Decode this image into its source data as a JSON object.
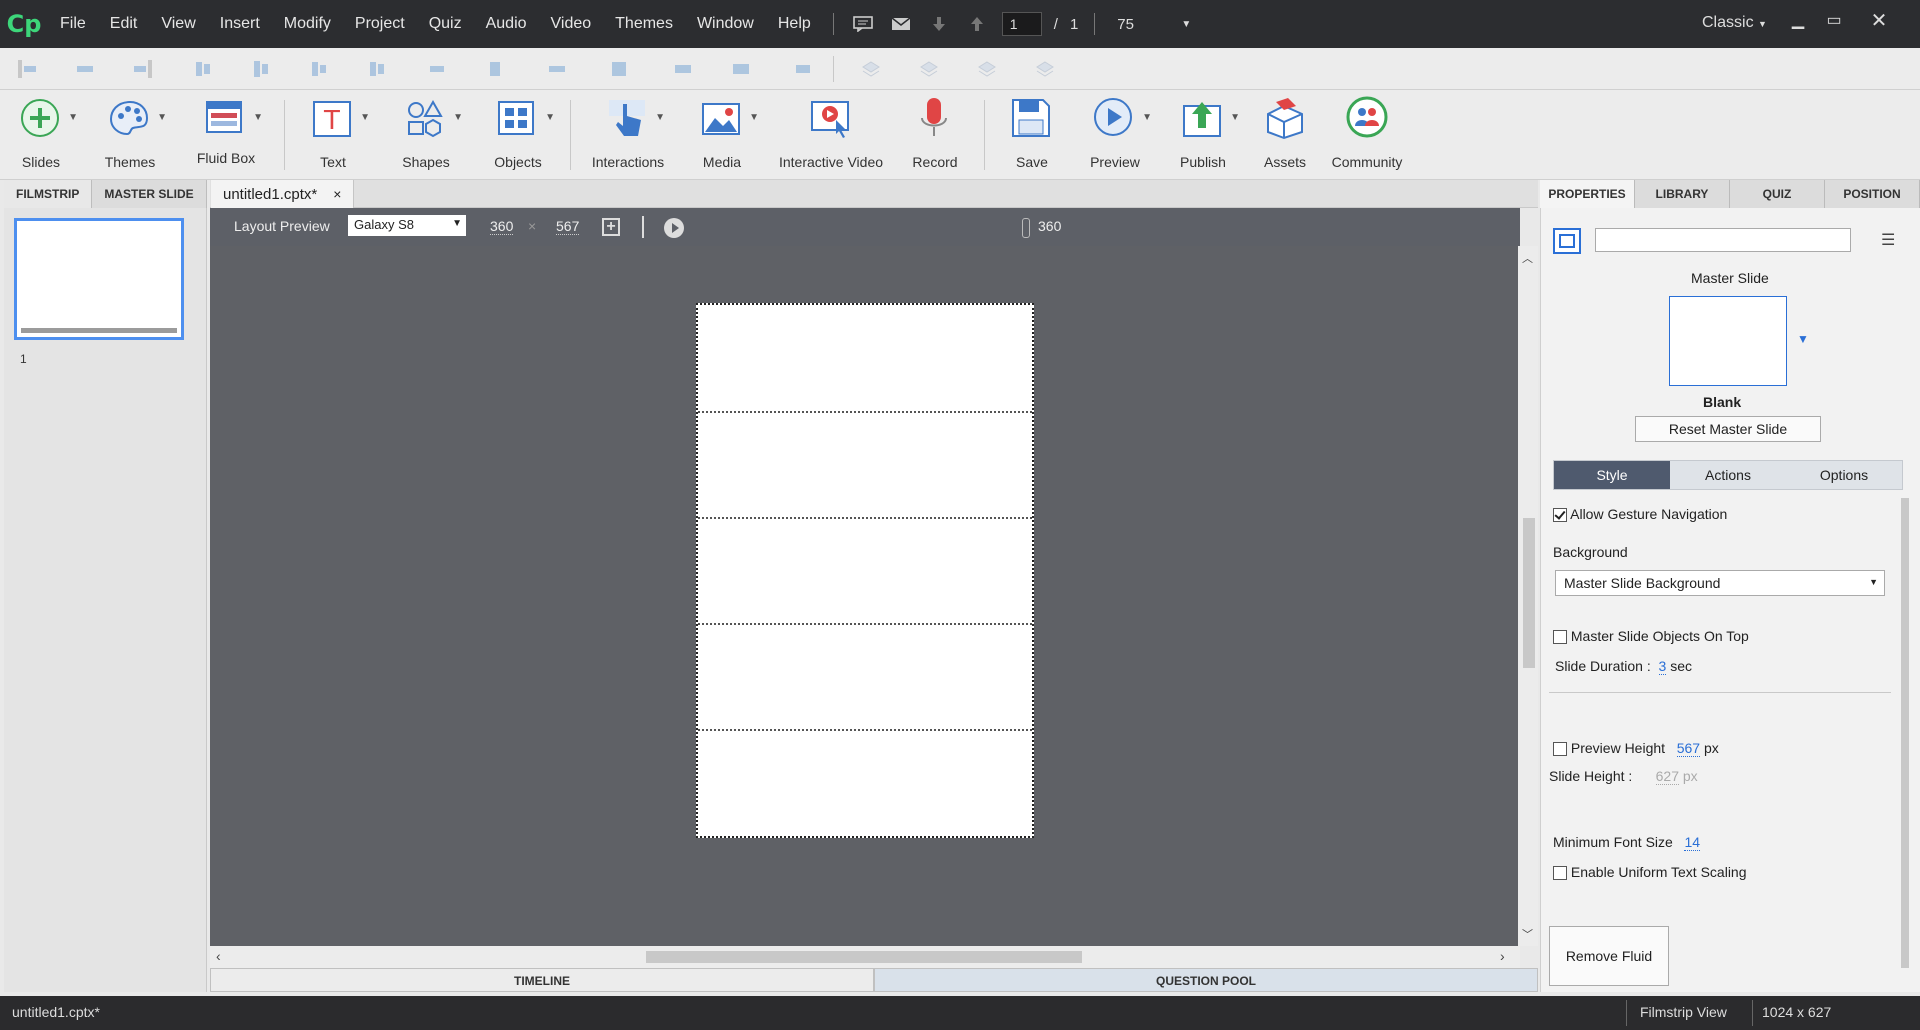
{
  "app": {
    "logo": "Cp",
    "menu": [
      "File",
      "Edit",
      "View",
      "Insert",
      "Modify",
      "Project",
      "Quiz",
      "Audio",
      "Video",
      "Themes",
      "Window",
      "Help"
    ],
    "page_current": "1",
    "page_sep": "/",
    "page_total": "1",
    "zoom": "75",
    "workspace": "Classic"
  },
  "toolbar": {
    "slides": "Slides",
    "themes": "Themes",
    "fluid_box": "Fluid Box",
    "text": "Text",
    "shapes": "Shapes",
    "objects": "Objects",
    "interactions": "Interactions",
    "media": "Media",
    "interactive_video": "Interactive Video",
    "record": "Record",
    "save": "Save",
    "preview": "Preview",
    "publish": "Publish",
    "assets": "Assets",
    "community": "Community"
  },
  "left_panel": {
    "tab_filmstrip": "FILMSTRIP",
    "tab_master": "MASTER SLIDE",
    "slide_number": "1"
  },
  "document": {
    "tab_title": "untitled1.cptx*",
    "close": "×"
  },
  "stagebar": {
    "label": "Layout Preview",
    "device": "Galaxy S8",
    "width": "360",
    "times": "×",
    "height": "567",
    "ruler_value": "360"
  },
  "bottom_tabs": {
    "timeline": "TIMELINE",
    "question_pool": "QUESTION POOL"
  },
  "right_panel": {
    "tabs": [
      "PROPERTIES",
      "LIBRARY",
      "QUIZ",
      "POSITION"
    ],
    "master_slide_label": "Master Slide",
    "master_name": "Blank",
    "reset_button": "Reset Master Slide",
    "subtabs": [
      "Style",
      "Actions",
      "Options"
    ],
    "allow_gesture": "Allow Gesture Navigation",
    "background_label": "Background",
    "background_value": "Master Slide Background",
    "master_objects_on_top": "Master Slide Objects On Top",
    "slide_duration_label": "Slide Duration :",
    "slide_duration_value": "3",
    "slide_duration_unit": "sec",
    "preview_height_label": "Preview Height",
    "preview_height_value": "567",
    "preview_height_unit": "px",
    "slide_height_label": "Slide Height :",
    "slide_height_value": "627",
    "slide_height_unit": "px",
    "min_font_label": "Minimum Font Size",
    "min_font_value": "14",
    "uniform_scaling": "Enable Uniform Text Scaling",
    "remove_fluid": "Remove Fluid Boxes"
  },
  "status": {
    "file": "untitled1.cptx*",
    "view": "Filmstrip View",
    "size": "1024 x 627"
  },
  "colors": {
    "accent": "#4d8fef",
    "stage": "#5f6166",
    "menubar": "#2c2d30",
    "subtab_active": "#4f5a6e"
  }
}
